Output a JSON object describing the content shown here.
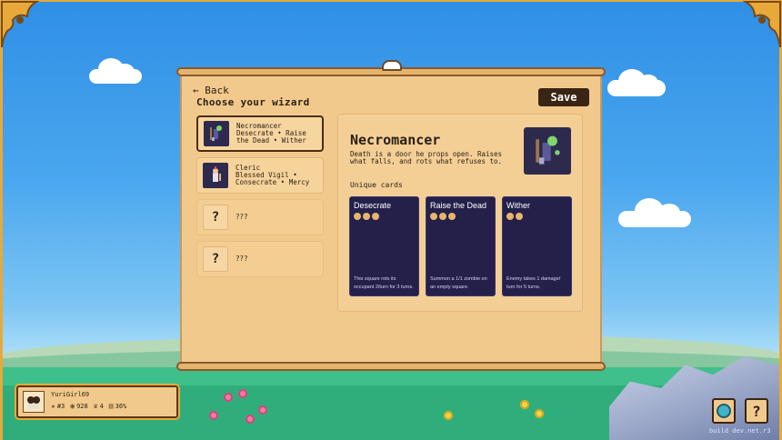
{
  "screen": {
    "back_label": "← Back",
    "heading": "Choose your wizard",
    "save_label": "Save"
  },
  "wizards": [
    {
      "name": "Necromancer",
      "sub1": "Desecrate • Raise",
      "sub2": "the Dead • Wither",
      "selected": true
    },
    {
      "name": "Cleric",
      "sub1": "Blessed Vigil •",
      "sub2": "Consecrate • Mercy",
      "selected": false
    },
    {
      "name": "???",
      "thumb": "?",
      "locked": true
    },
    {
      "name": "???",
      "thumb": "?",
      "locked": true
    }
  ],
  "detail": {
    "title": "Necromancer",
    "description": "Death is a door he props open. Raises what falls, and rots what refuses to.",
    "unique_label": "Unique cards",
    "cards": [
      {
        "name": "Desecrate",
        "cost": 3,
        "text": "This square rots its occupant 2/turn for 3 turns."
      },
      {
        "name": "Raise the Dead",
        "cost": 3,
        "text": "Summon a 1/1 zombie on an empty square."
      },
      {
        "name": "Wither",
        "cost": 2,
        "text": "Enemy takes 1 damage/ turn for 5 turns."
      }
    ]
  },
  "player": {
    "name": "YuriGirl69",
    "rank": "#3",
    "coins": "928",
    "trophies": "4",
    "win_rate": "36%"
  },
  "footer": {
    "build_text": "build dev.net.r3"
  },
  "colors": {
    "parchment": "#f2c98c",
    "dark_brown": "#3a2414",
    "card_navy": "#24204a",
    "pip": "#e8b46c",
    "frame_gold": "#e8a93a"
  }
}
